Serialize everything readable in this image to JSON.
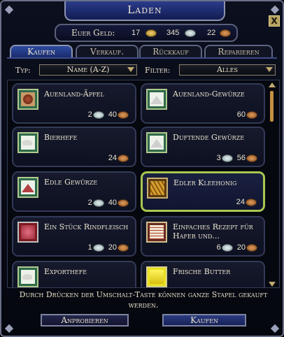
{
  "window": {
    "title": "Laden",
    "close_glyph": "X"
  },
  "money": {
    "label": "Euer Geld:",
    "gold": "17",
    "silver": "345",
    "copper": "22"
  },
  "tabs": [
    {
      "label": "Kaufen",
      "active": true
    },
    {
      "label": "Verkauf.",
      "active": false
    },
    {
      "label": "Rückkauf",
      "active": false
    },
    {
      "label": "Reparieren",
      "active": false
    }
  ],
  "filters": {
    "type_label": "Typ:",
    "type_value": "Name (A-Z)",
    "filter_label": "Filter:",
    "filter_value": "Alles"
  },
  "items": [
    {
      "name": "Auenland-Äpfel",
      "silver": "2",
      "copper": "40",
      "icon": "apple-icon"
    },
    {
      "name": "Auenland-Gewürze",
      "silver": "",
      "copper": "60",
      "icon": "spice-pile-icon"
    },
    {
      "name": "Bierhefe",
      "silver": "",
      "copper": "24",
      "icon": "yeast-icon"
    },
    {
      "name": "Duftende Gewürze",
      "silver": "3",
      "copper": "56",
      "icon": "spice-pile-icon"
    },
    {
      "name": "Edle Gewürze",
      "silver": "2",
      "copper": "40",
      "icon": "red-spice-icon"
    },
    {
      "name": "Edler Kleehonig",
      "silver": "",
      "copper": "24",
      "icon": "honeycomb-icon"
    },
    {
      "name": "Ein Stück Rindfleisch",
      "silver": "1",
      "copper": "20",
      "icon": "beef-icon"
    },
    {
      "name": "Einfaches Rezept für Hafer und...",
      "silver": "6",
      "copper": "20",
      "icon": "recipe-icon"
    },
    {
      "name": "Exporthefe",
      "silver": "",
      "copper": "",
      "icon": "yeast-icon"
    },
    {
      "name": "Frische Butter",
      "silver": "",
      "copper": "",
      "icon": "butter-icon"
    }
  ],
  "selected_item": "Edler Kleehonig",
  "hint": "Durch Drücken der Umschalt-Taste können ganze Stapel gekauft werden.",
  "buttons": {
    "preview": "Anprobieren",
    "buy": "Kaufen"
  },
  "colors": {
    "selected_border": "#a8c850",
    "tab_active": "#2d4aa0",
    "scroll_thumb": "#c49040"
  }
}
